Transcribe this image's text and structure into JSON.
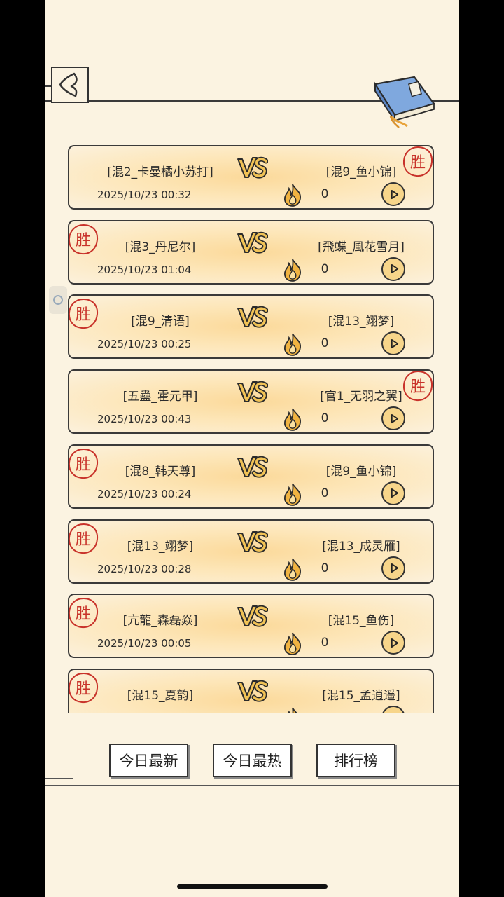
{
  "matches": [
    {
      "p1": "[混2_卡曼橘小苏打]",
      "p2": "[混9_鱼小锦]",
      "date": "2025/10/23 00:32",
      "count": "0",
      "winner": "right"
    },
    {
      "p1": "[混3_丹尼尔]",
      "p2": "[飛蝶_風花雪月]",
      "date": "2025/10/23 01:04",
      "count": "0",
      "winner": "left"
    },
    {
      "p1": "[混9_清语]",
      "p2": "[混13_翊梦]",
      "date": "2025/10/23 00:25",
      "count": "0",
      "winner": "left"
    },
    {
      "p1": "[五蠱_霍元甲]",
      "p2": "[官1_无羽之翼]",
      "date": "2025/10/23 00:43",
      "count": "0",
      "winner": "right"
    },
    {
      "p1": "[混8_韩天尊]",
      "p2": "[混9_鱼小锦]",
      "date": "2025/10/23 00:24",
      "count": "0",
      "winner": "left"
    },
    {
      "p1": "[混13_翊梦]",
      "p2": "[混13_成灵雁]",
      "date": "2025/10/23 00:28",
      "count": "0",
      "winner": "left"
    },
    {
      "p1": "[亢龍_森磊焱]",
      "p2": "[混15_鱼伤]",
      "date": "2025/10/23 00:05",
      "count": "0",
      "winner": "left"
    },
    {
      "p1": "[混15_夏韵]",
      "p2": "[混15_孟逍遥]",
      "date": "",
      "count": "",
      "winner": "left"
    }
  ],
  "vs_text": "VS",
  "stamp_text": "胜",
  "tabs": {
    "today_newest": "今日最新",
    "today_hottest": "今日最热",
    "ranking": "排行榜"
  },
  "icons": [
    "back-arrow-icon",
    "book-icon",
    "fire-icon",
    "play-icon",
    "win-stamp-icon"
  ]
}
